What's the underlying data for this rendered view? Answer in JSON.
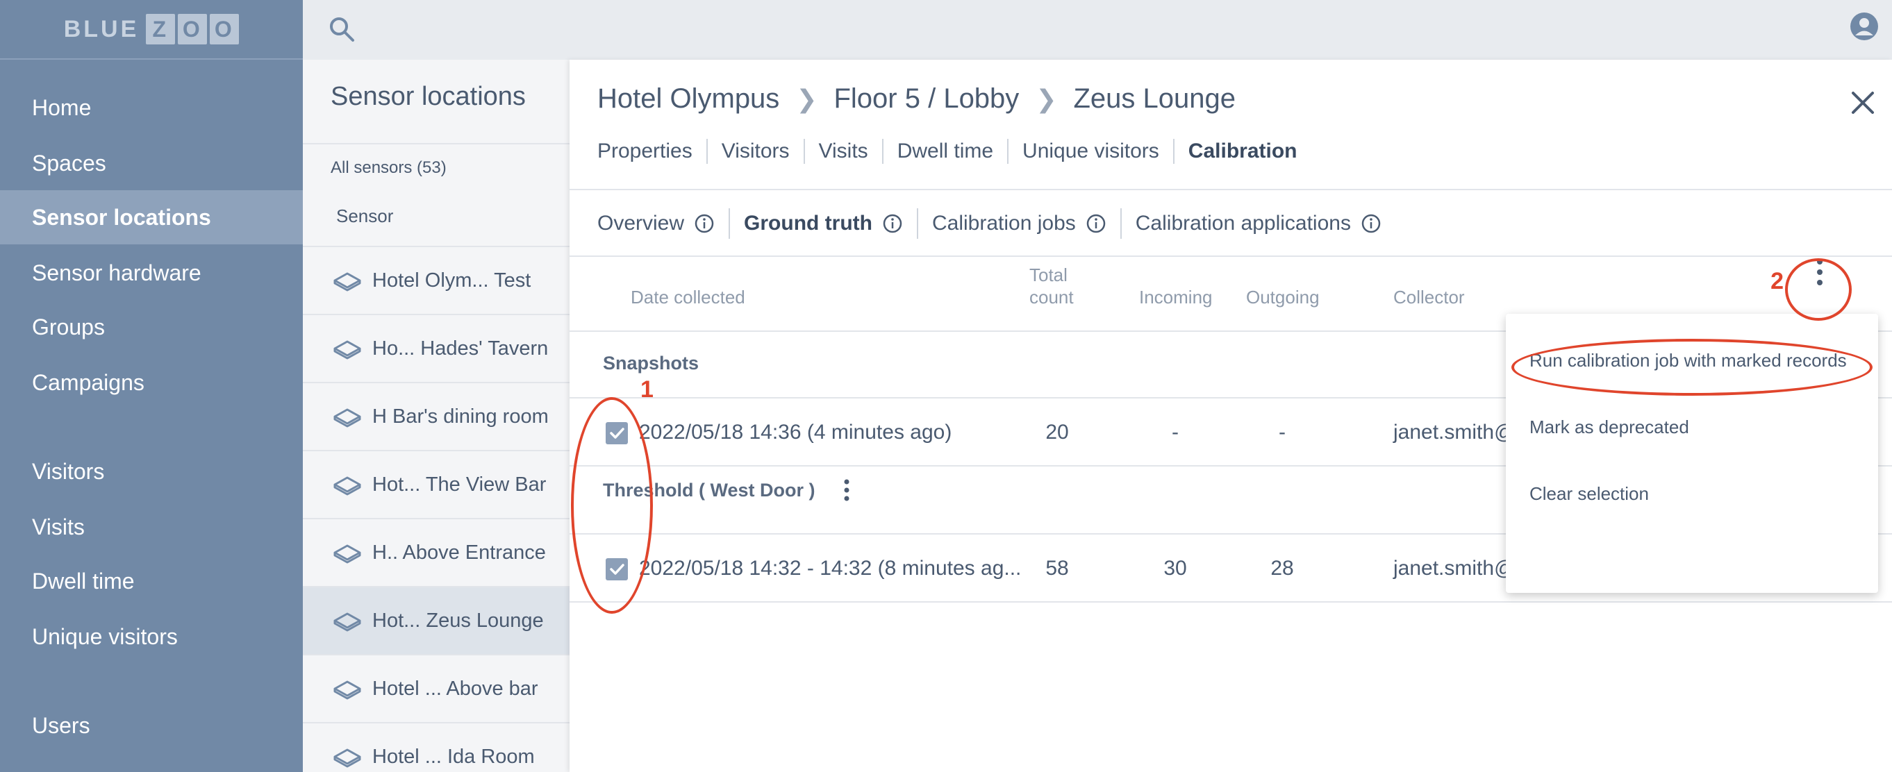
{
  "logo": {
    "word": "BLUE",
    "boxes": [
      "Z",
      "O",
      "O"
    ]
  },
  "nav": {
    "items": [
      {
        "label": "Home"
      },
      {
        "label": "Spaces"
      },
      {
        "label": "Sensor locations",
        "active": true
      },
      {
        "label": "Sensor hardware"
      },
      {
        "label": "Groups"
      },
      {
        "label": "Campaigns"
      },
      {
        "label": "Visitors"
      },
      {
        "label": "Visits"
      },
      {
        "label": "Dwell time"
      },
      {
        "label": "Unique visitors"
      },
      {
        "label": "Users"
      }
    ]
  },
  "sensor_list": {
    "title": "Sensor locations",
    "count": "All sensors (53)",
    "column": "Sensor",
    "rows": [
      "Hotel Olym...   Test",
      "Ho... Hades' Tavern",
      "H Bar's dining room",
      "Hot... The View Bar",
      "H.. Above Entrance",
      "Hot...  Zeus Lounge",
      "Hotel ...  Above bar",
      "Hotel ...   Ida Room"
    ],
    "selected_index": 5
  },
  "breadcrumb": [
    "Hotel Olympus",
    "Floor 5 / Lobby",
    "Zeus Lounge"
  ],
  "tabs": [
    {
      "label": "Properties"
    },
    {
      "label": "Visitors"
    },
    {
      "label": "Visits"
    },
    {
      "label": "Dwell time"
    },
    {
      "label": "Unique visitors"
    },
    {
      "label": "Calibration",
      "active": true
    }
  ],
  "subtabs": [
    {
      "label": "Overview"
    },
    {
      "label": "Ground truth",
      "active": true
    },
    {
      "label": "Calibration jobs"
    },
    {
      "label": "Calibration applications"
    }
  ],
  "table": {
    "headers": {
      "date": "Date collected",
      "total_line1": "Total",
      "total_line2": "count",
      "incoming": "Incoming",
      "outgoing": "Outgoing",
      "collector": "Collector"
    },
    "sections": [
      {
        "title": "Snapshots",
        "row": {
          "checked": true,
          "date": "2022/05/18 14:36 (4 minutes ago)",
          "total": "20",
          "incoming": "-",
          "outgoing": "-",
          "collector": "janet.smith@"
        }
      },
      {
        "title": "Threshold ( West Door )",
        "row": {
          "checked": true,
          "date": "2022/05/18 14:32 - 14:32 (8 minutes ag...",
          "total": "58",
          "incoming": "30",
          "outgoing": "28",
          "collector": "janet.smith@bluezoo.io"
        }
      }
    ]
  },
  "menu": {
    "items": [
      "Run calibration job with marked records",
      "Mark as deprecated",
      "Clear selection"
    ]
  },
  "annotations": {
    "one": "1",
    "two": "2"
  },
  "colors": {
    "nav_bg": "#7189a6",
    "nav_active": "#8ea2bb",
    "annotation": "#e0452c",
    "checkbox": "#8c9fb8"
  }
}
